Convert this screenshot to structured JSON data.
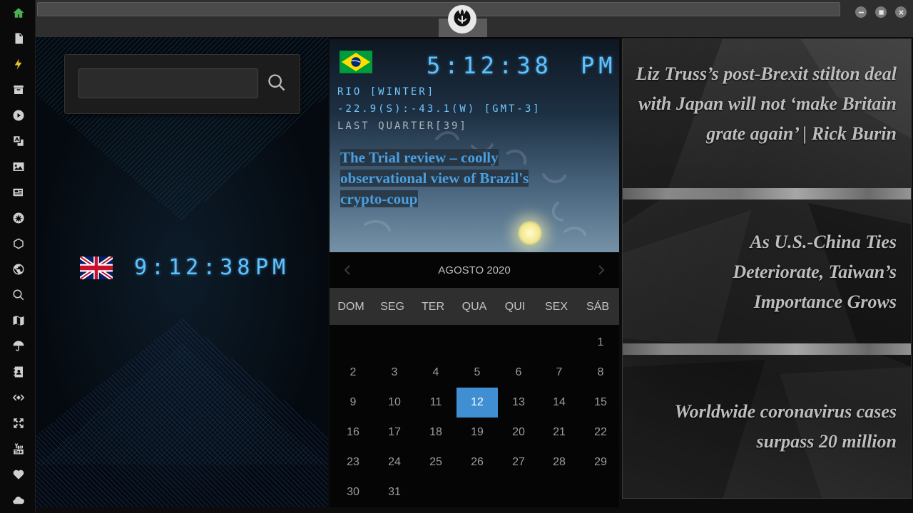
{
  "sidebar": {
    "items": [
      {
        "icon": "home-icon",
        "name": "sidebar-item-home"
      },
      {
        "icon": "document-icon",
        "name": "sidebar-item-documents"
      },
      {
        "icon": "bolt-icon",
        "name": "sidebar-item-quick"
      },
      {
        "icon": "archive-icon",
        "name": "sidebar-item-archive"
      },
      {
        "icon": "play-icon",
        "name": "sidebar-item-media"
      },
      {
        "icon": "translate-icon",
        "name": "sidebar-item-translate"
      },
      {
        "icon": "image-icon",
        "name": "sidebar-item-images"
      },
      {
        "icon": "news-icon",
        "name": "sidebar-item-news"
      },
      {
        "icon": "rebel-icon",
        "name": "sidebar-item-rebel"
      },
      {
        "icon": "hexagon-icon",
        "name": "sidebar-item-hexagon"
      },
      {
        "icon": "globe-icon",
        "name": "sidebar-item-globe"
      },
      {
        "icon": "search-icon",
        "name": "sidebar-item-search"
      },
      {
        "icon": "map-icon",
        "name": "sidebar-item-map"
      },
      {
        "icon": "umbrella-icon",
        "name": "sidebar-item-weather"
      },
      {
        "icon": "contacts-icon",
        "name": "sidebar-item-contacts"
      },
      {
        "icon": "code-icon",
        "name": "sidebar-item-code"
      },
      {
        "icon": "expand-icon",
        "name": "sidebar-item-expand"
      },
      {
        "icon": "youtube-icon",
        "name": "sidebar-item-youtube"
      },
      {
        "icon": "heart-icon",
        "name": "sidebar-item-favorites"
      },
      {
        "icon": "cloud-icon",
        "name": "sidebar-item-cloud"
      }
    ]
  },
  "window": {
    "logo_icon": "rebel-alliance-icon",
    "buttons": [
      "minimize-icon",
      "maximize-icon",
      "close-icon"
    ]
  },
  "search": {
    "value": "",
    "icon": "search-icon"
  },
  "uk_clock": {
    "flag": "uk-flag",
    "time": "9:12:38",
    "ampm": "PM"
  },
  "brazil_clock": {
    "flag": "brazil-flag",
    "time": "5:12:38",
    "ampm": "PM",
    "location": "RIO [WINTER]",
    "coords": "-22.9(S):-43.1(W) [GMT-3]",
    "moon": "LAST QUARTER[39]",
    "headline": "The Trial review – coolly observational view of Brazil's crypto-coup"
  },
  "calendar": {
    "month": "AGOSTO 2020",
    "prev_icon": "chevron-left-icon",
    "next_icon": "chevron-right-icon",
    "day_names": [
      "DOM",
      "SEG",
      "TER",
      "QUA",
      "QUI",
      "SEX",
      "SÁB"
    ],
    "days": [
      "1",
      "2",
      "3",
      "4",
      "5",
      "6",
      "7",
      "8",
      "9",
      "10",
      "11",
      "12",
      "13",
      "14",
      "15",
      "16",
      "17",
      "18",
      "19",
      "20",
      "21",
      "22",
      "23",
      "24",
      "25",
      "26",
      "27",
      "28",
      "29",
      "30",
      "31"
    ],
    "today": "12",
    "accent": "#3f8fd2"
  },
  "news": {
    "items": [
      "Liz Truss’s post-Brexit stilton deal with Japan will not ‘make Britain grate again’ | Rick Burin",
      "As U.S.-China Ties Deteriorate, Taiwan’s Importance Grows",
      "Worldwide coronavirus cases surpass 20 million"
    ]
  },
  "colors": {
    "digital": "#5ec2ff",
    "active_icon": "#4caf50",
    "bolt": "#e8c22a"
  }
}
